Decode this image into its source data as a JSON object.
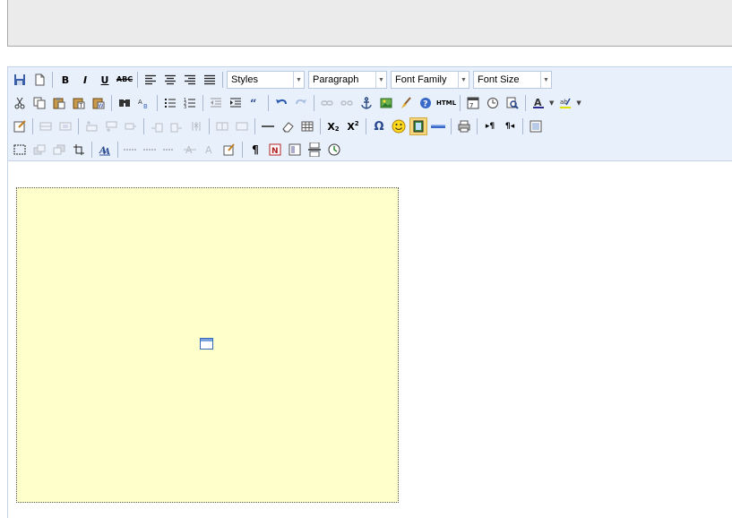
{
  "toolbar": {
    "row1": {
      "styles": "Styles",
      "format": "Paragraph",
      "font_family": "Font Family",
      "font_size": "Font Size",
      "bold": "B",
      "italic": "I",
      "underline": "U",
      "strikethrough": "ABC"
    },
    "row3": {
      "subscript": "X",
      "subscript_mark": "2",
      "superscript": "X",
      "superscript_mark": "2",
      "charmap": "Ω",
      "ltr": "▸¶",
      "rtl": "¶◂"
    },
    "row2": {
      "html": "HTML"
    },
    "row4": {
      "pilcrow": "¶"
    }
  },
  "icons": [
    "save-icon",
    "new-document-icon",
    "cut-icon",
    "copy-icon",
    "paste-icon",
    "paste-text-icon",
    "paste-word-icon",
    "search-icon",
    "replace-icon",
    "bullet-list-icon",
    "numbered-list-icon",
    "outdent-icon",
    "indent-icon",
    "blockquote-icon",
    "undo-icon",
    "redo-icon",
    "link-icon",
    "unlink-icon",
    "anchor-icon",
    "image-icon",
    "cleanup-icon",
    "help-icon",
    "insert-date-icon",
    "insert-time-icon",
    "preview-icon",
    "text-color-icon",
    "background-color-icon",
    "table-icon",
    "horizontal-rule-icon",
    "eraser-icon",
    "emotions-icon",
    "media-icon",
    "print-icon",
    "fullscreen-icon",
    "layer-icon",
    "style-icon",
    "template-icon",
    "pagebreak-icon"
  ]
}
